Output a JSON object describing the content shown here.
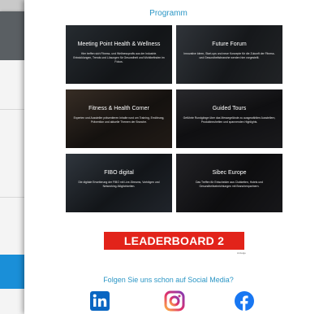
{
  "programm": {
    "title": "Programm"
  },
  "cards": [
    {
      "title": "Meeting Point Health & Wellness",
      "desc": "Hier treffen sich Fitness- und Wellnessprofis aus der Industrie. Entwicklungen, Trends und Lösungen für Gesundheit und Wohlbefinden im Fokus.",
      "tint": "#4a5a6a"
    },
    {
      "title": "Future Forum",
      "desc": "Innovative Ideen, Start-ups und neue Konzepte für die Zukunft der Fitness- und Gesundheitsbranche werden hier vorgestellt.",
      "tint": "#5a6470"
    },
    {
      "title": "Fitness & Health Corner",
      "desc": "Experten und Aussteller präsentieren Inhalte rund um Training, Ernährung, Prävention und aktuelle Themen der Branche.",
      "tint": "#6a5a4a"
    },
    {
      "title": "Guided Tours",
      "desc": "Geführte Rundgänge über das Messegelände zu ausgewählten Ausstellern, Produktneuheiten und spannenden Highlights.",
      "tint": "#4a4a50"
    },
    {
      "title": "FIBO digital",
      "desc": "Die digitale Erweiterung der FIBO mit Live-Streams, Vorträgen und Networking-Möglichkeiten.",
      "tint": "#5a6878"
    },
    {
      "title": "Sibec Europe",
      "desc": "Das Treffen für Entscheider aus Clubketten, Hotels und Gesundheitseinrichtungen mit Branchenpartnern.",
      "tint": "#3e3e44"
    }
  ],
  "leaderboard": {
    "label": "LEADERBOARD 2",
    "tag": "Anzeige"
  },
  "social": {
    "heading": "Folgen Sie uns schon auf Social Media?",
    "icons": [
      "linkedin-icon",
      "instagram-icon",
      "facebook-icon"
    ]
  },
  "colors": {
    "accent": "#2b96c5",
    "leaderboard": "#e2231a",
    "linkedin": "#0a66c2",
    "facebook": "#1877f2"
  }
}
